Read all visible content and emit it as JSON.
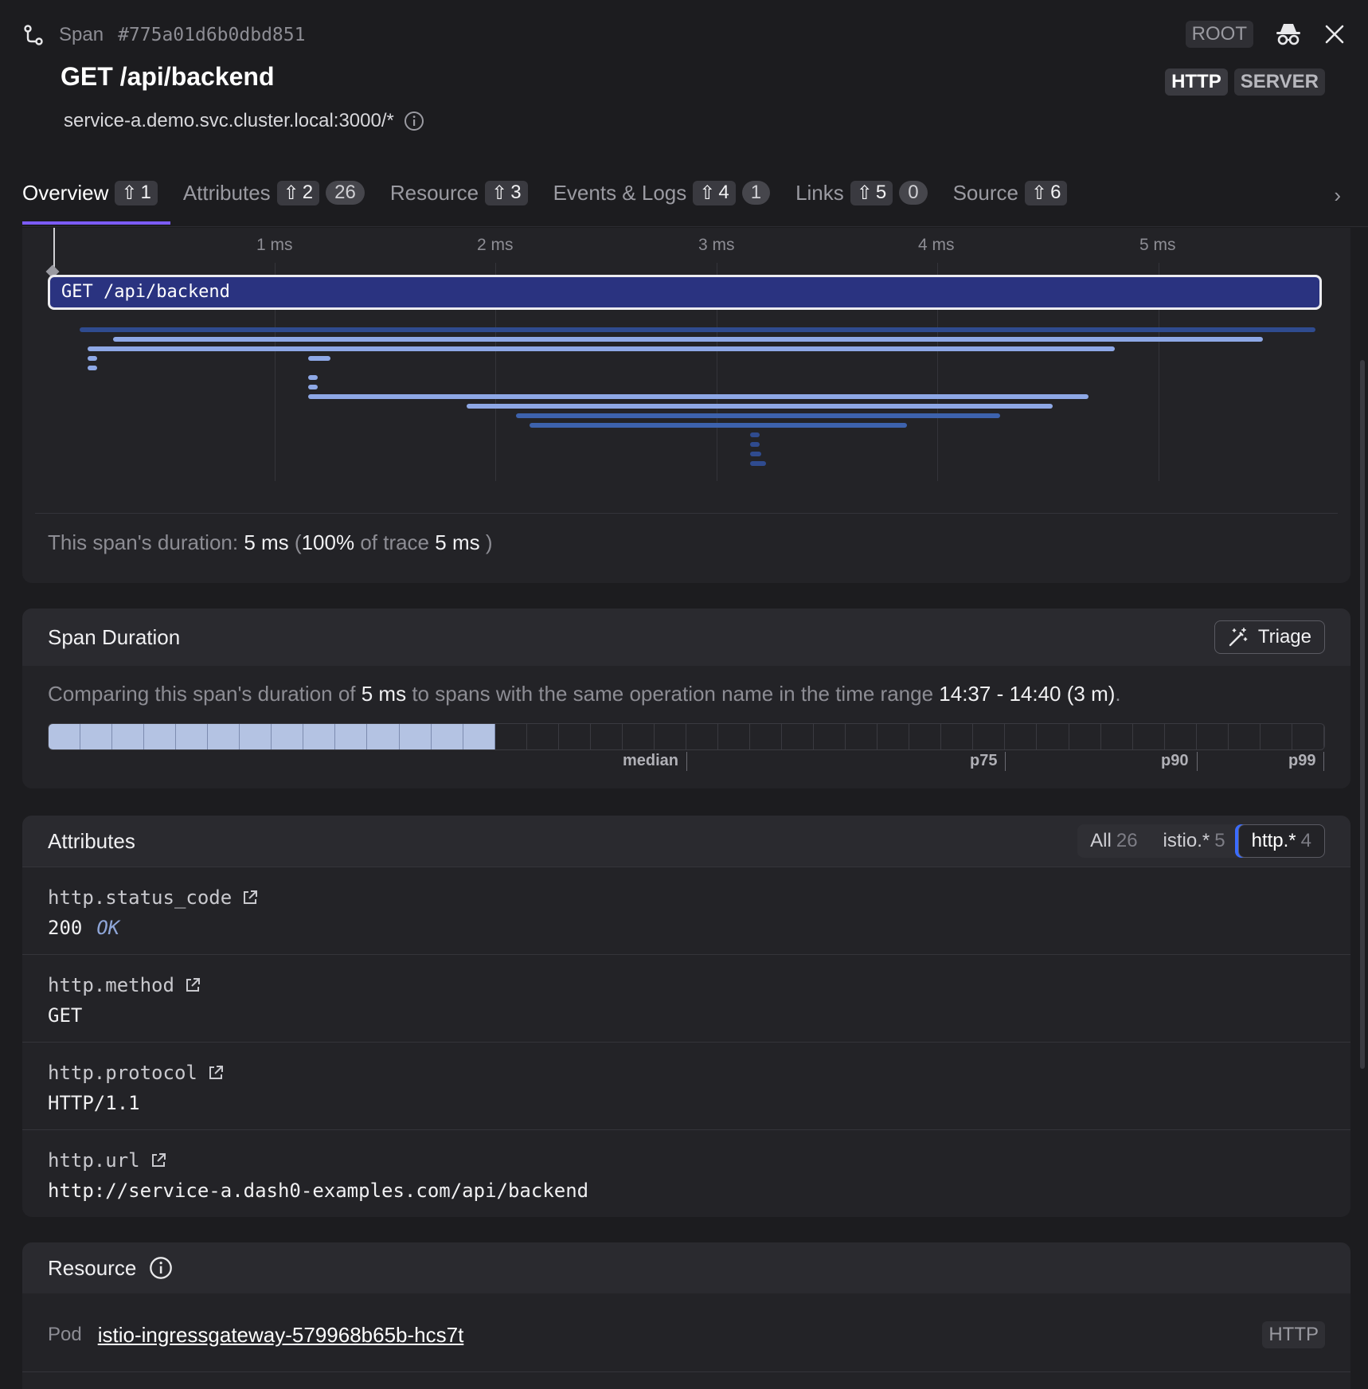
{
  "header": {
    "kind_label": "Span",
    "span_id": "#775a01d6b0dbd851",
    "root_badge": "ROOT",
    "title": "GET /api/backend",
    "subtitle": "service-a.demo.svc.cluster.local:3000/*",
    "chips": [
      "HTTP",
      "SERVER"
    ]
  },
  "tabs": [
    {
      "label": "Overview",
      "key": "1",
      "count": null
    },
    {
      "label": "Attributes",
      "key": "2",
      "count": "26"
    },
    {
      "label": "Resource",
      "key": "3",
      "count": null
    },
    {
      "label": "Events & Logs",
      "key": "4",
      "count": "1"
    },
    {
      "label": "Links",
      "key": "5",
      "count": "0"
    },
    {
      "label": "Source",
      "key": "6",
      "count": null
    }
  ],
  "timeline": {
    "ticks": [
      "1 ms",
      "2 ms",
      "3 ms",
      "4 ms",
      "5 ms"
    ],
    "root_span_label": "GET /api/backend",
    "duration": {
      "prefix": "This span's duration:",
      "value": "5 ms",
      "open": "(",
      "percent": "100%",
      "of_trace": "of trace",
      "trace_value": "5 ms",
      "close": ")"
    }
  },
  "span_duration": {
    "title": "Span Duration",
    "triage_label": "Triage",
    "text_a": "Comparing this span's duration of",
    "value": "5 ms",
    "text_b": "to spans with the same operation name in the time range",
    "range": "14:37 - 14:40 (3 m)",
    "period": ".",
    "histogram_filled": 14,
    "histogram_total": 40,
    "percentiles": [
      "median",
      "p75",
      "p90",
      "p99"
    ]
  },
  "attributes": {
    "title": "Attributes",
    "filters": [
      {
        "label": "All",
        "count": "26"
      },
      {
        "label": "istio.*",
        "count": "5"
      },
      {
        "label": "http.*",
        "count": "4"
      }
    ],
    "rows": [
      {
        "key": "http.status_code",
        "value": "200",
        "note": "OK"
      },
      {
        "key": "http.method",
        "value": "GET",
        "note": ""
      },
      {
        "key": "http.protocol",
        "value": "HTTP/1.1",
        "note": ""
      },
      {
        "key": "http.url",
        "value": "http://service-a.dash0-examples.com/api/backend",
        "note": ""
      }
    ]
  },
  "resource": {
    "title": "Resource",
    "pod_label": "Pod",
    "pod_value": "istio-ingressgateway-579968b65b-hcs7t",
    "pod_chip": "HTTP"
  },
  "colors": {
    "accent": "#7c5cff",
    "root_bar": "#2a3380",
    "child_light": "#8ea8e6",
    "child_dark": "#2f4b8f",
    "hist_fill": "#b4c3e3"
  }
}
